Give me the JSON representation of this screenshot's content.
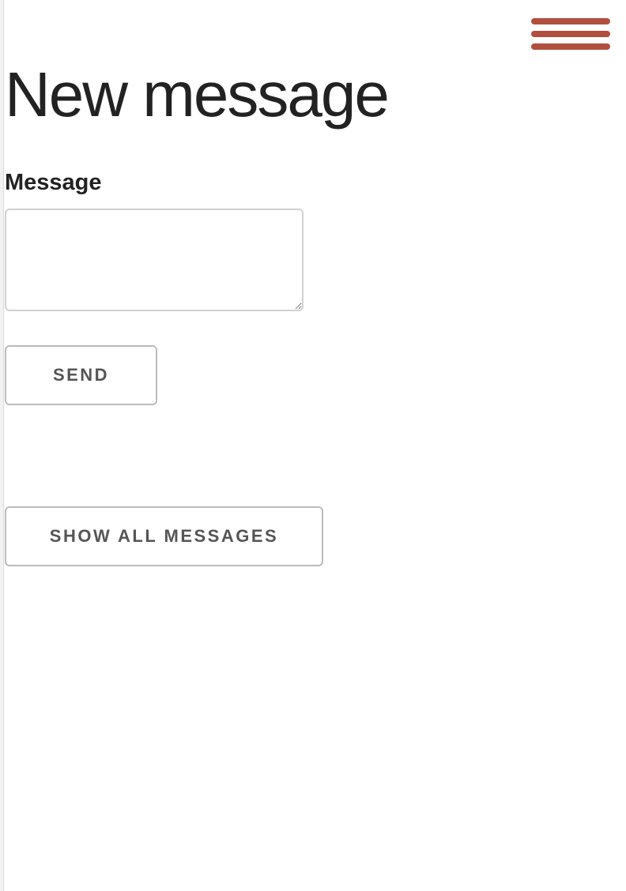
{
  "colors": {
    "menu_accent": "#b04f3e",
    "text": "#222222",
    "button_text": "#555555",
    "border": "#d1d1d1"
  },
  "header": {
    "menu_icon": "hamburger-menu-icon"
  },
  "main": {
    "title": "New message",
    "message_label": "Message",
    "message_value": "",
    "send_label": "SEND",
    "show_all_label": "SHOW ALL MESSAGES"
  }
}
